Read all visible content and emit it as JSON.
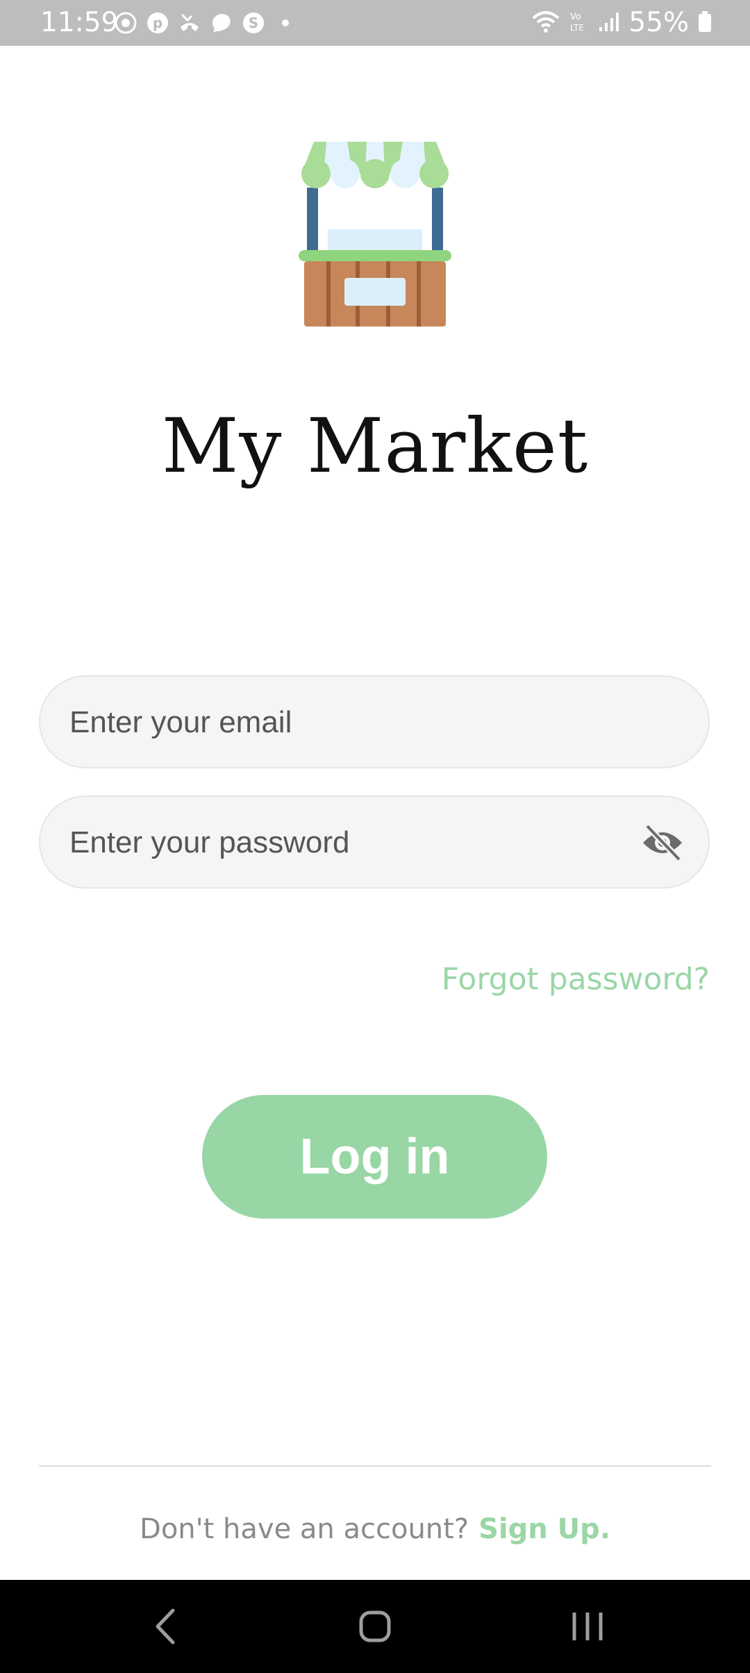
{
  "status_bar": {
    "time": "11:59",
    "battery": "55%",
    "icons_left": [
      "settings-icon",
      "pinterest-icon",
      "missed-call-icon",
      "chat-bubble-icon",
      "app-s-icon",
      "dot-icon"
    ],
    "icons_right": [
      "wifi-icon",
      "volte-icon",
      "signal-icon",
      "battery-icon"
    ]
  },
  "app": {
    "title": "My Market",
    "logo": "market-stall-icon"
  },
  "login_form": {
    "email_placeholder": "Enter your email",
    "password_placeholder": "Enter your password",
    "password_toggle_icon": "eye-off-icon",
    "forgot_password": "Forgot password?",
    "login_button": "Log in"
  },
  "footer": {
    "signup_prompt": "Don't have an account?",
    "signup_link": "Sign Up."
  },
  "nav_bar": {
    "items": [
      "back-icon",
      "home-icon",
      "recents-icon"
    ]
  },
  "colors": {
    "accent": "#98d6a5",
    "status_bar_bg": "#bdbdbd",
    "field_bg": "#f5f5f5"
  }
}
